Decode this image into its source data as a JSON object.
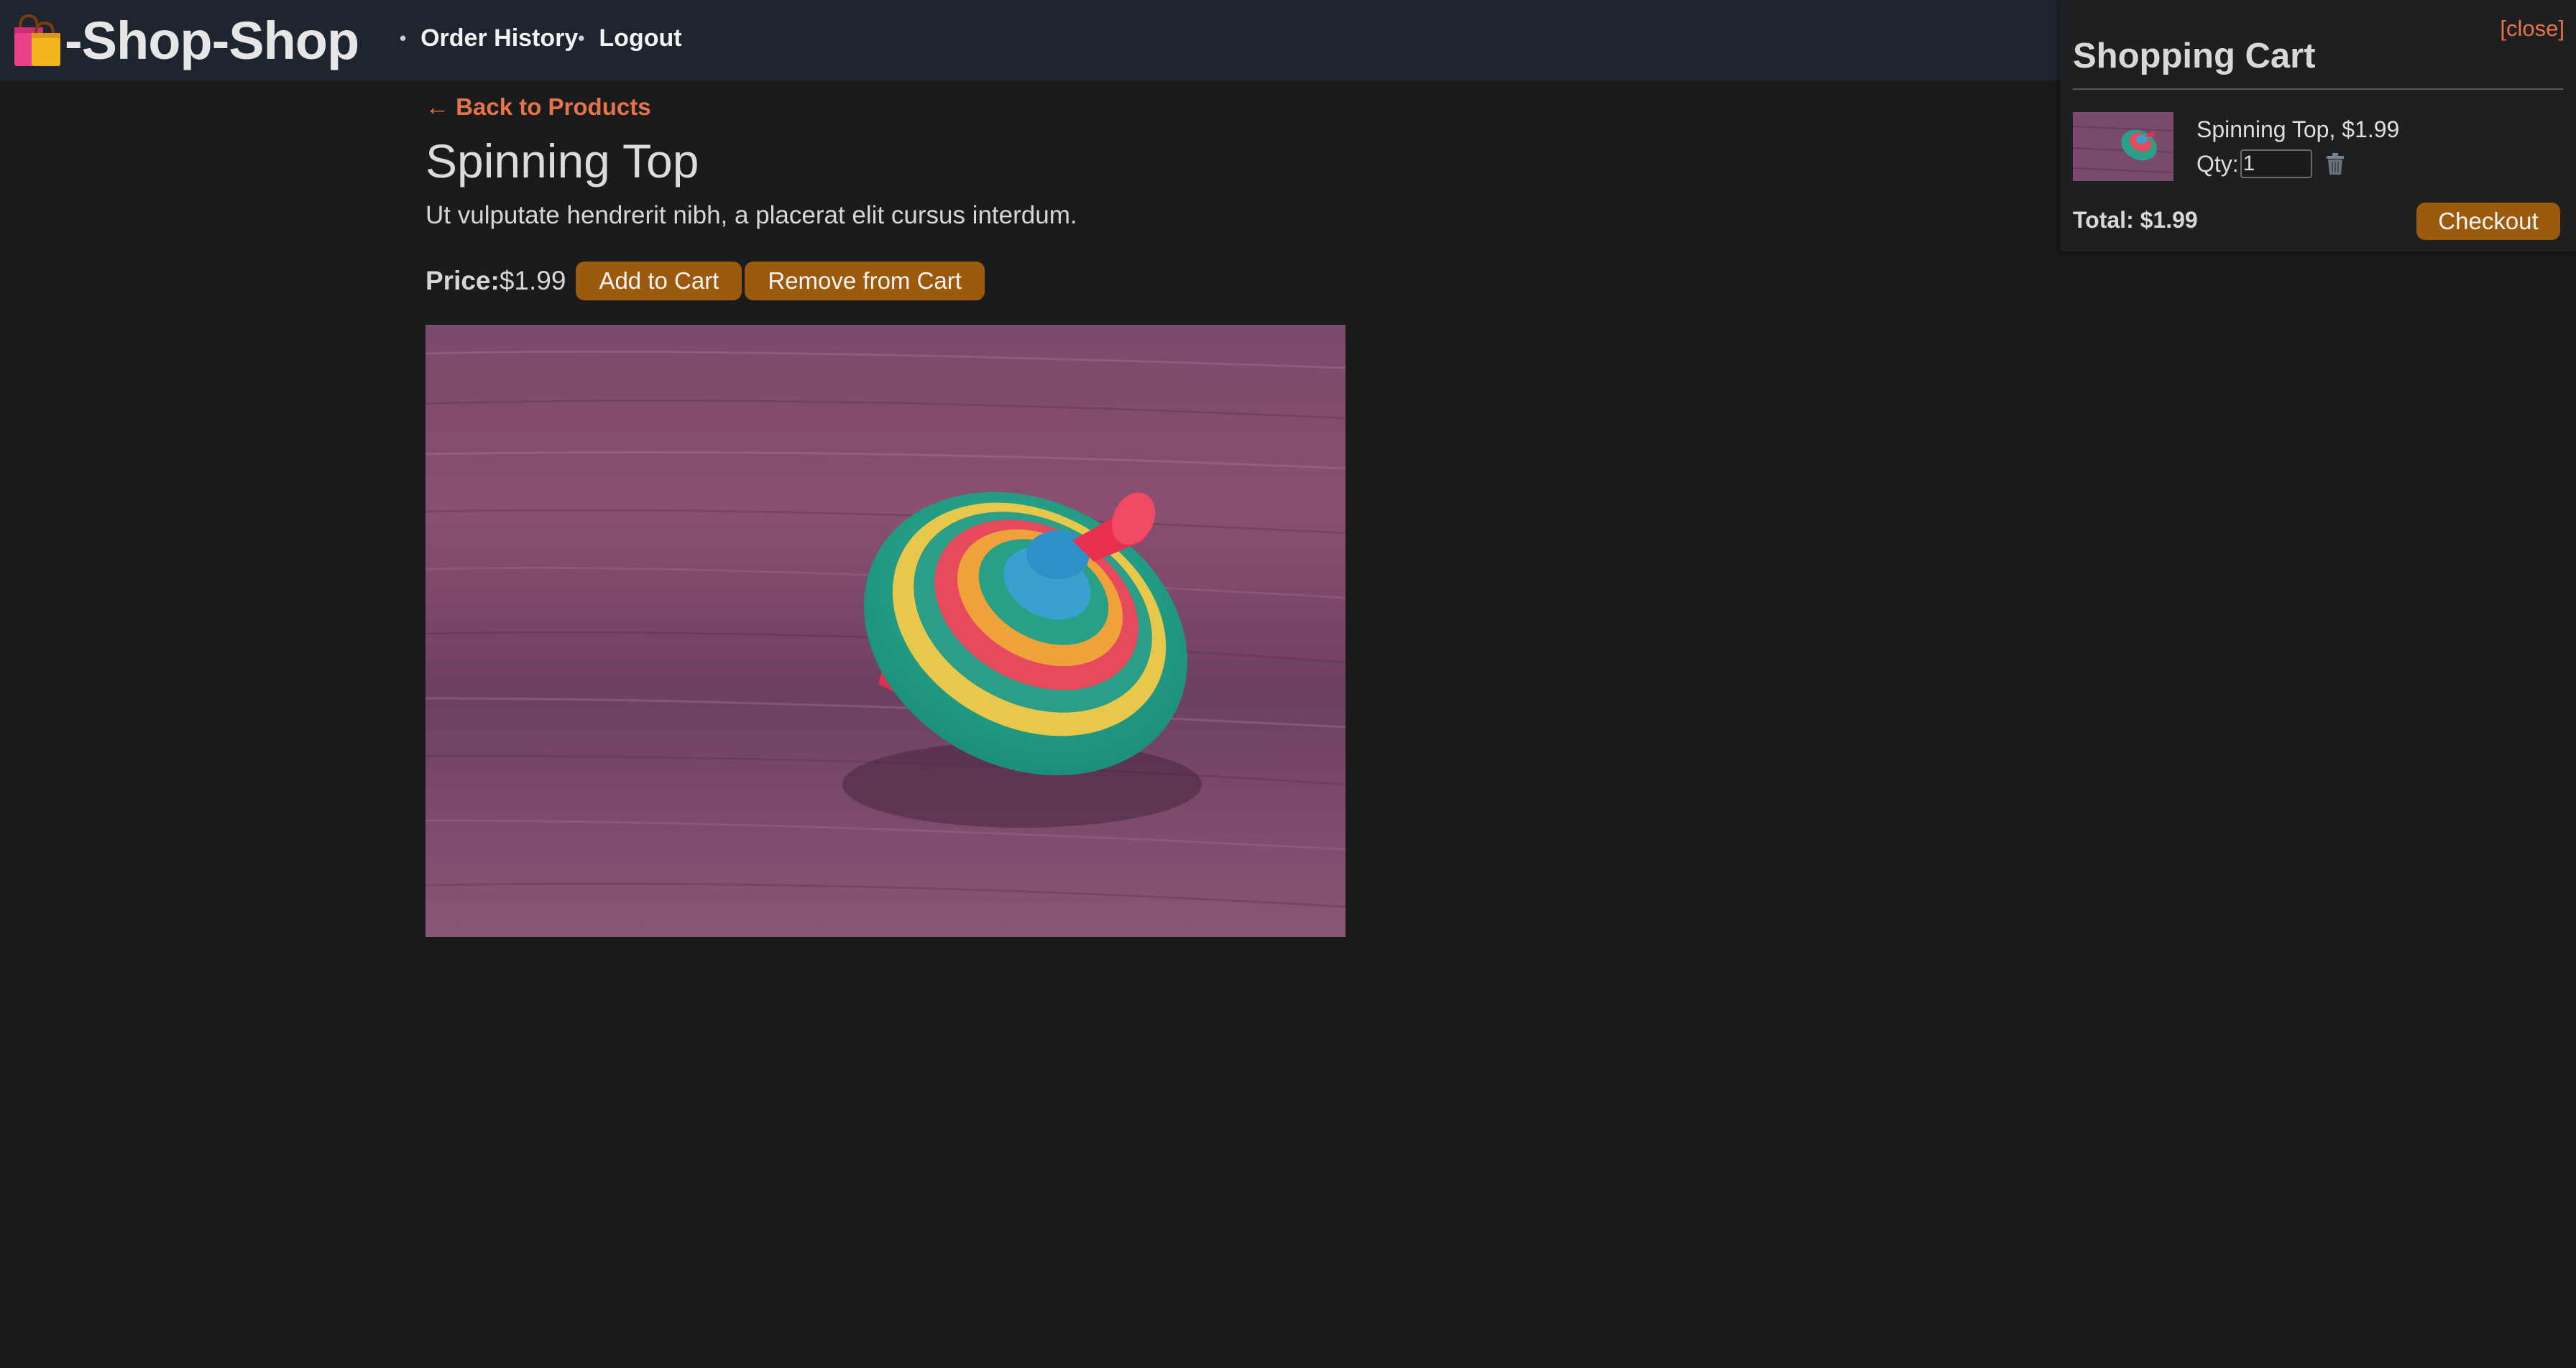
{
  "header": {
    "logo_text": "-Shop-Shop",
    "logo_icon": "shopping-bags-icon",
    "nav": [
      {
        "label": "Order History"
      },
      {
        "label": "Logout"
      }
    ]
  },
  "product": {
    "back_link": "← Back to Products",
    "title": "Spinning Top",
    "description": "Ut vulputate hendrerit nibh, a placerat elit cursus interdum.",
    "price_label": "Price:",
    "price_value": "$1.99",
    "add_button": "Add to Cart",
    "remove_button": "Remove from Cart",
    "image_subject": "spinning-top-photo"
  },
  "cart": {
    "close_label": "[close]",
    "title": "Shopping Cart",
    "items": [
      {
        "name": "Spinning Top, $1.99",
        "qty_label": "Qty:",
        "qty_value": "1"
      }
    ],
    "total": "Total: $1.99",
    "checkout_label": "Checkout"
  },
  "colors": {
    "background": "#1a1b1d",
    "header": "#1e252f",
    "accent_link": "#e8734a",
    "button": "#9c5a0c"
  }
}
